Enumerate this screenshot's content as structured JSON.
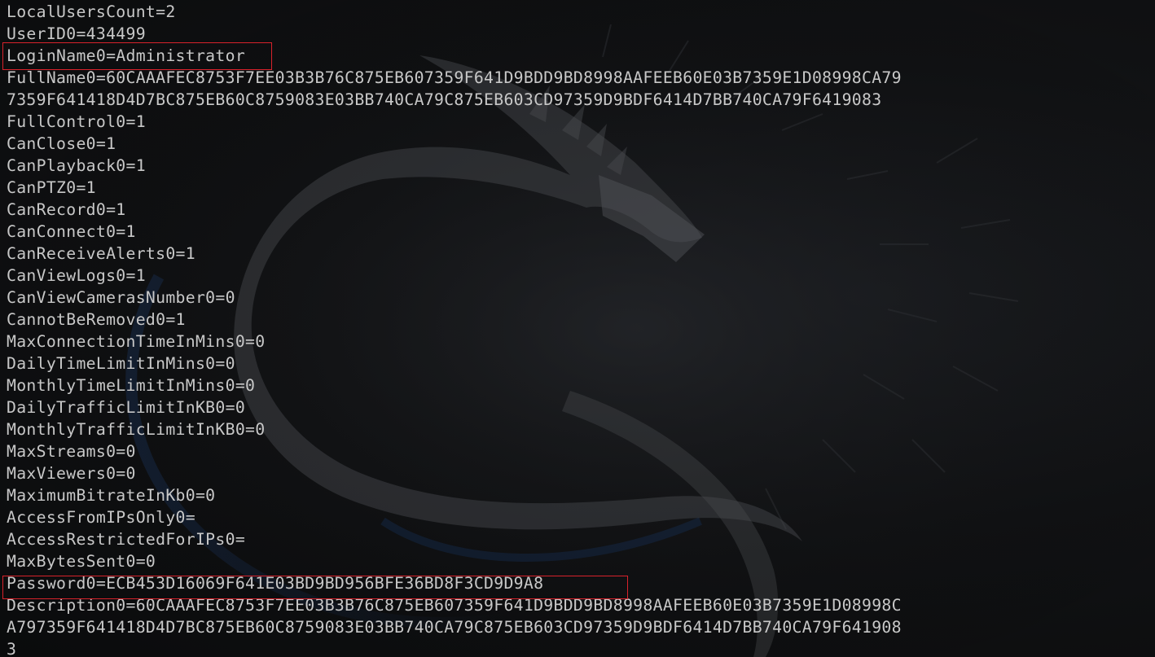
{
  "terminal": {
    "lines": [
      "LocalUsersCount=2",
      "UserID0=434499",
      "LoginName0=Administrator",
      "FullName0=60CAAAFEC8753F7EE03B3B76C875EB607359F641D9BDD9BD8998AAFEEB60E03B7359E1D08998CA79",
      "7359F641418D4D7BC875EB60C8759083E03BB740CA79C875EB603CD97359D9BDF6414D7BB740CA79F6419083",
      "FullControl0=1",
      "CanClose0=1",
      "CanPlayback0=1",
      "CanPTZ0=1",
      "CanRecord0=1",
      "CanConnect0=1",
      "CanReceiveAlerts0=1",
      "CanViewLogs0=1",
      "CanViewCamerasNumber0=0",
      "CannotBeRemoved0=1",
      "MaxConnectionTimeInMins0=0",
      "DailyTimeLimitInMins0=0",
      "MonthlyTimeLimitInMins0=0",
      "DailyTrafficLimitInKB0=0",
      "MonthlyTrafficLimitInKB0=0",
      "MaxStreams0=0",
      "MaxViewers0=0",
      "MaximumBitrateInKb0=0",
      "AccessFromIPsOnly0=",
      "AccessRestrictedForIPs0=",
      "MaxBytesSent0=0",
      "Password0=ECB453D16069F641E03BD9BD956BFE36BD8F3CD9D9A8",
      "Description0=60CAAAFEC8753F7EE03B3B76C875EB607359F641D9BDD9BD8998AAFEEB60E03B7359E1D08998C",
      "A797359F641418D4D7BC875EB60C8759083E03BB740CA79C875EB603CD97359D9BDF6414D7BB740CA79F641908",
      "3"
    ]
  },
  "colors": {
    "text": "#c8c8c8",
    "highlight_border": "#d8222b",
    "background": "#0b0c0e"
  },
  "background_art": "kali-dragon-wallpaper"
}
